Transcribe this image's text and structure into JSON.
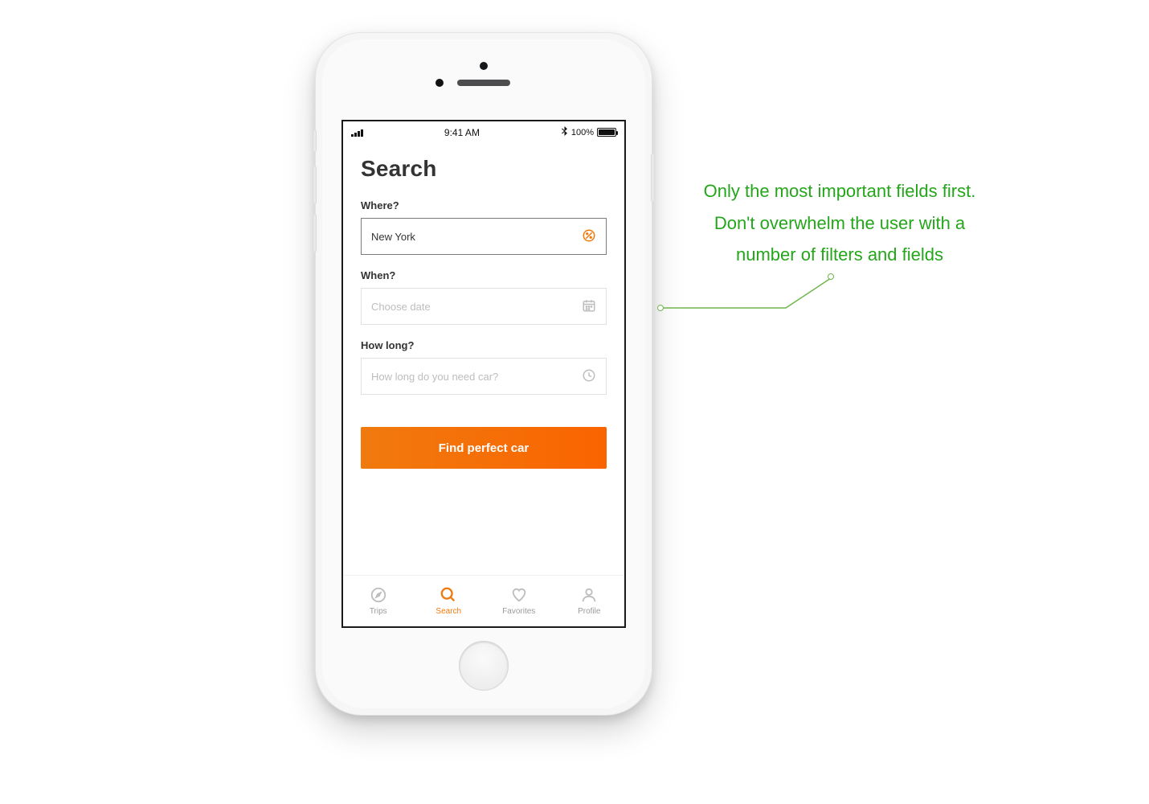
{
  "statusbar": {
    "time": "9:41 AM",
    "battery_text": "100%"
  },
  "page": {
    "title": "Search"
  },
  "fields": {
    "where": {
      "label": "Where?",
      "value": "New York"
    },
    "when": {
      "label": "When?",
      "placeholder": "Choose date"
    },
    "howlong": {
      "label": "How long?",
      "placeholder": "How long do you need car?"
    }
  },
  "cta": {
    "label": "Find perfect car"
  },
  "tabs": [
    {
      "label": "Trips"
    },
    {
      "label": "Search"
    },
    {
      "label": "Favorites"
    },
    {
      "label": "Profile"
    }
  ],
  "annotation": {
    "text": "Only the most important fields first. Don't overwhelm the user with a number of filters and fields"
  }
}
